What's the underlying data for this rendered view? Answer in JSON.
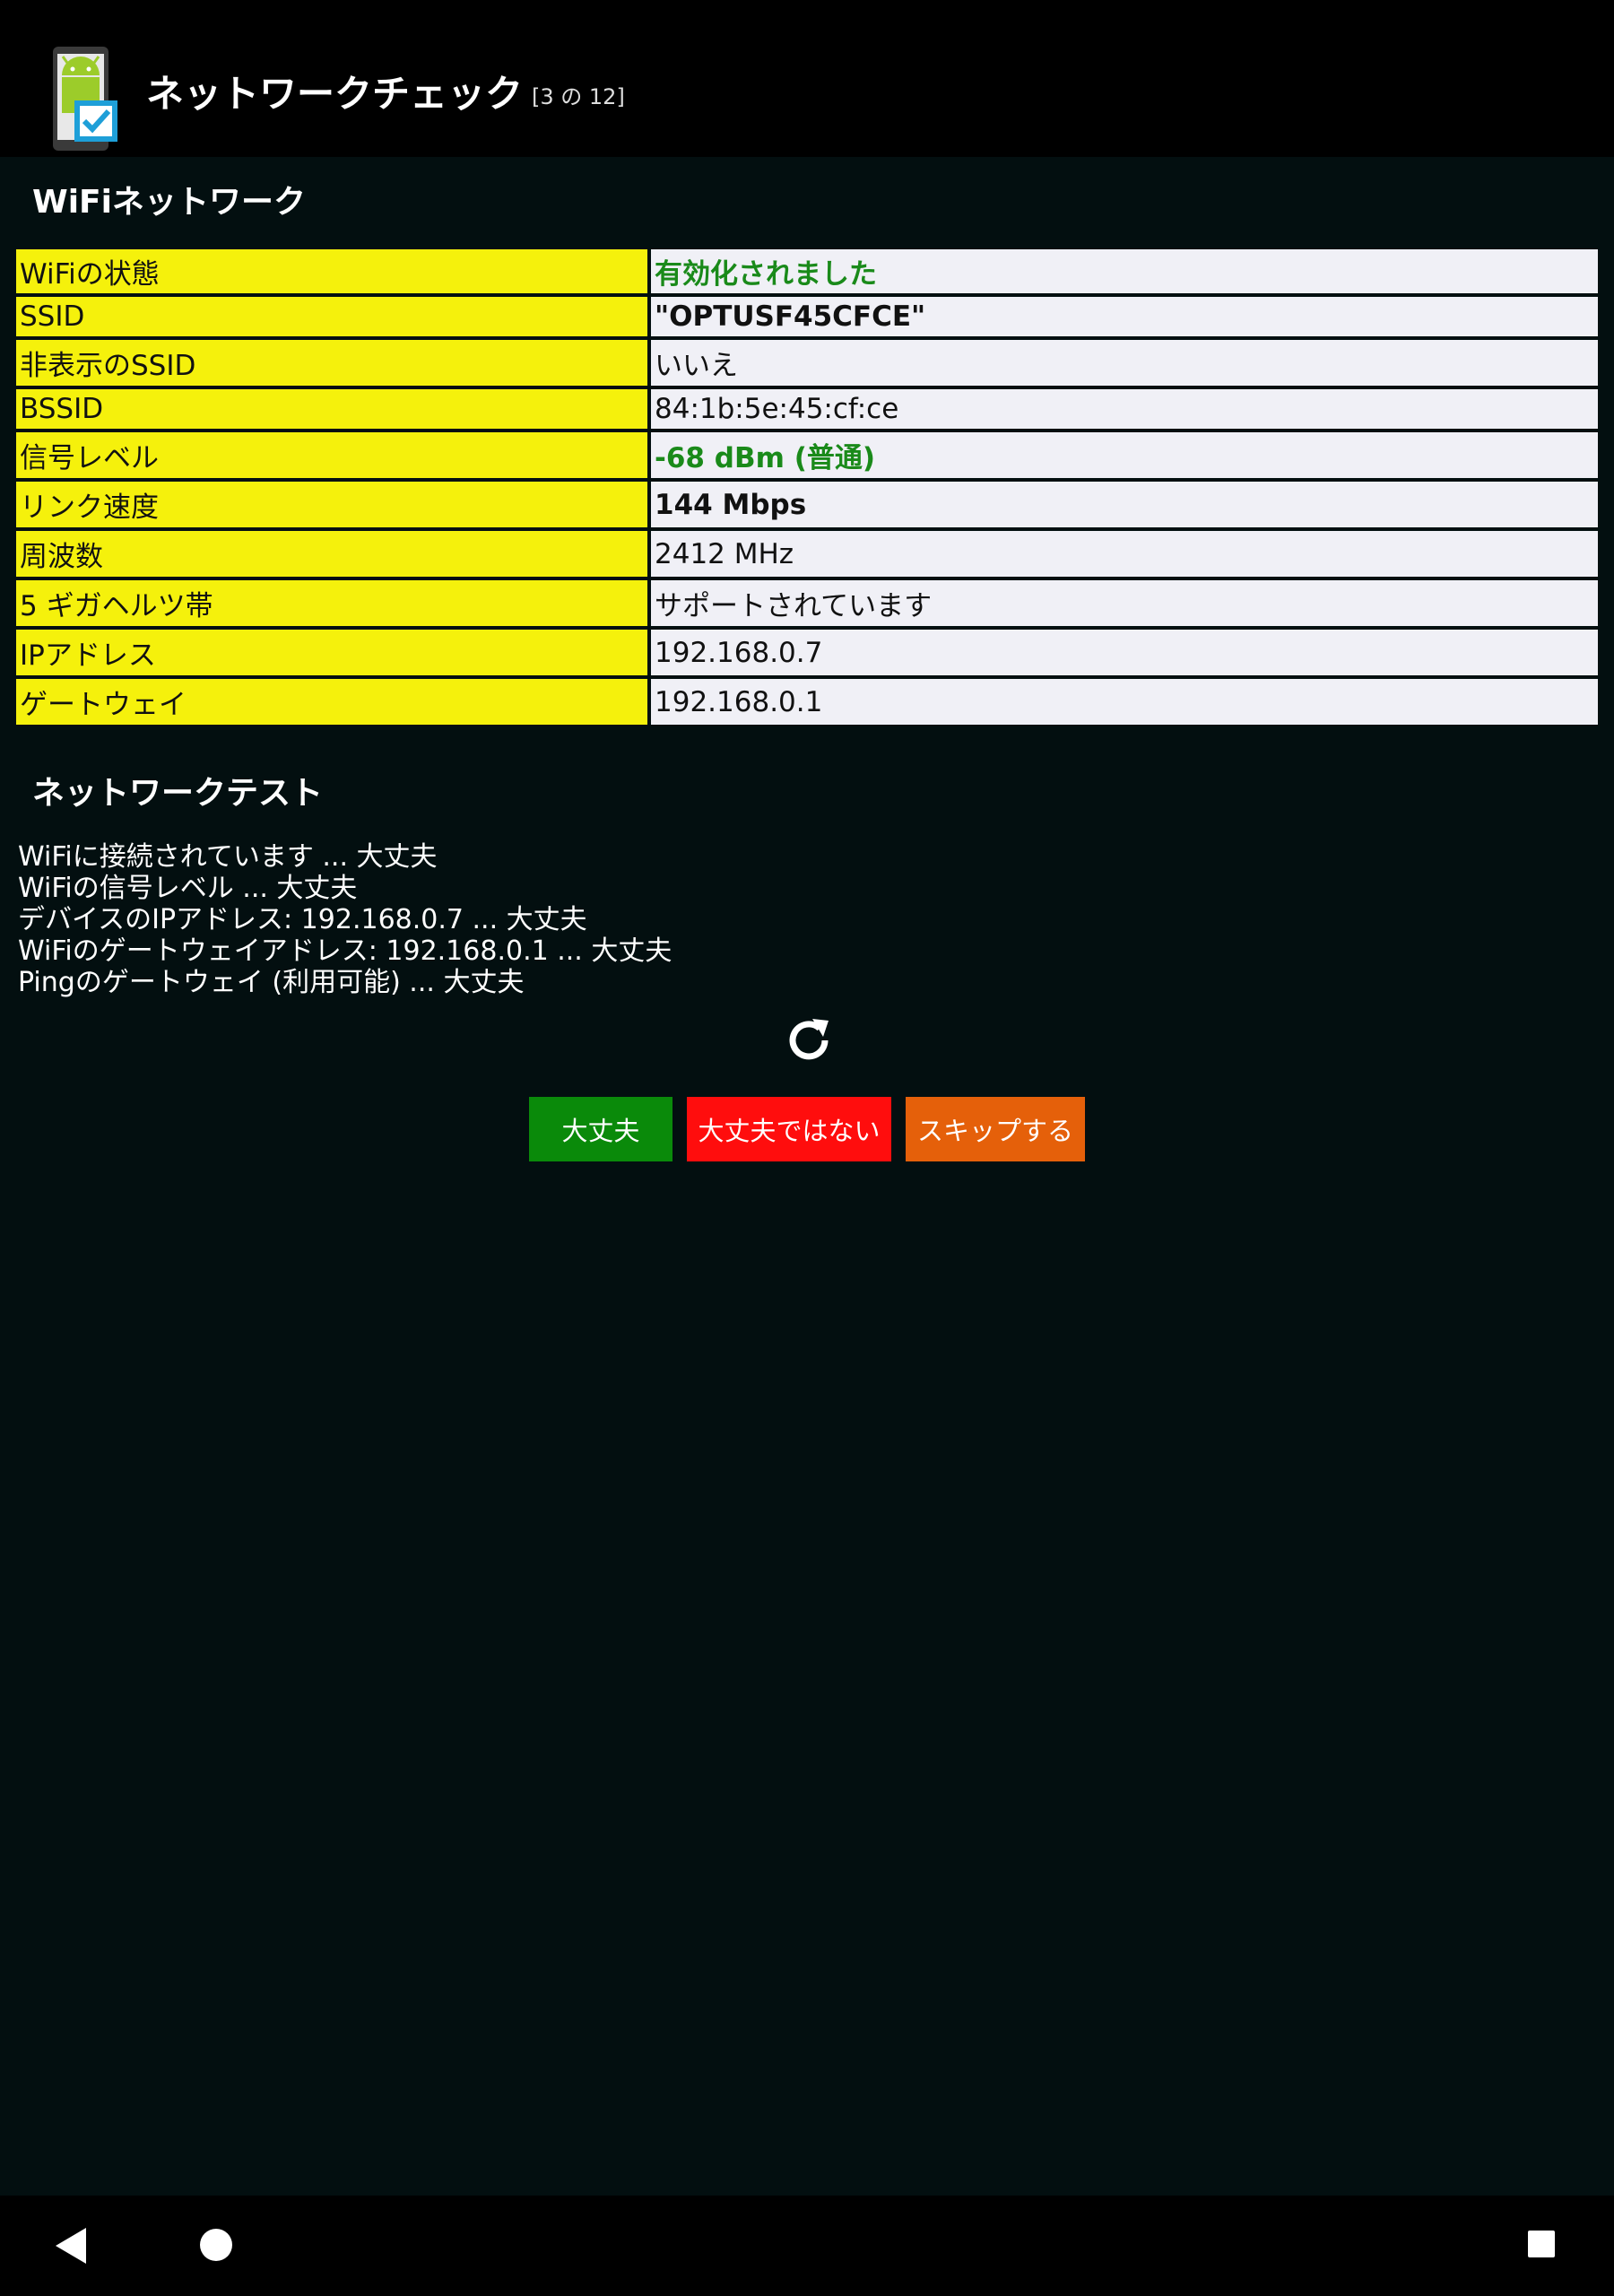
{
  "header": {
    "title": "ネットワークチェック",
    "counter": "[3 の 12]"
  },
  "wifi_section": {
    "title": "WiFiネットワーク",
    "rows": [
      {
        "label": "WiFiの状態",
        "value": "有効化されました"
      },
      {
        "label": "SSID",
        "value": "\"OPTUSF45CFCE\""
      },
      {
        "label": "非表示のSSID",
        "value": "いいえ"
      },
      {
        "label": "BSSID",
        "value": "84:1b:5e:45:cf:ce"
      },
      {
        "label": "信号レベル",
        "value": "-68 dBm (普通)"
      },
      {
        "label": "リンク速度",
        "value": "144 Mbps"
      },
      {
        "label": "周波数",
        "value": "2412 MHz"
      },
      {
        "label": "5 ギガヘルツ帯",
        "value": "サポートされています"
      },
      {
        "label": "IPアドレス",
        "value": "192.168.0.7"
      },
      {
        "label": "ゲートウェイ",
        "value": "192.168.0.1"
      }
    ]
  },
  "test_section": {
    "title": "ネットワークテスト",
    "lines": [
      "WiFiに接続されています ... 大丈夫",
      "WiFiの信号レベル ... 大丈夫",
      "デバイスのIPアドレス: 192.168.0.7 ... 大丈夫",
      "WiFiのゲートウェイアドレス: 192.168.0.1 ... 大丈夫",
      "Pingのゲートウェイ (利用可能) ... 大丈夫"
    ]
  },
  "buttons": {
    "ok": "大丈夫",
    "not_ok": "大丈夫ではない",
    "skip": "スキップする"
  },
  "colors": {
    "label_bg": "#f5f10c",
    "value_bg": "#f0f0f6",
    "status_green": "#1a8a1a",
    "ok_button": "#0a8a0a",
    "not_ok_button": "#ff0d0d",
    "skip_button": "#e5600a"
  },
  "icons": {
    "app": "android-checklist-icon",
    "refresh": "refresh-icon",
    "nav_back": "back-triangle-icon",
    "nav_home": "home-circle-icon",
    "nav_recent": "recent-apps-square-icon"
  }
}
